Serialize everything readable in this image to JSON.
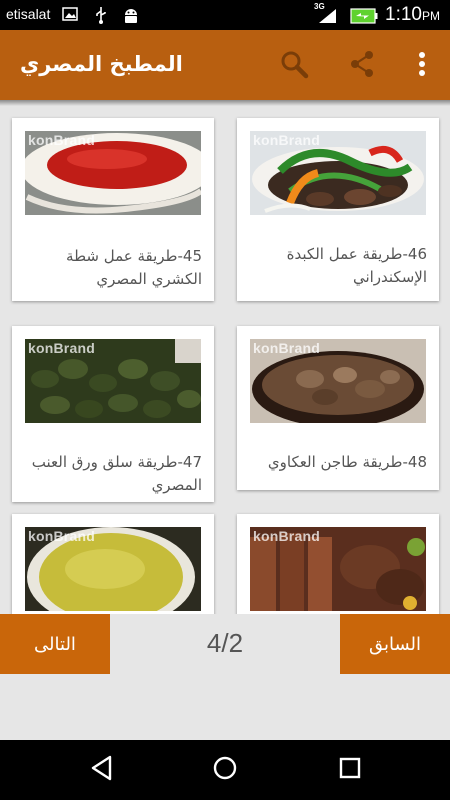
{
  "status_bar": {
    "carrier": "etisalat",
    "network": "3G",
    "time": "1:10",
    "ampm": "PM"
  },
  "app_bar": {
    "title": "المطبخ المصري",
    "icons": [
      "search-icon",
      "share-icon",
      "overflow-menu-icon"
    ]
  },
  "cards": [
    {
      "title": "46-طريقة عمل الكبدة الإسكندراني",
      "image": "liver-with-peppers",
      "watermark": [
        "kon",
        "Brand"
      ]
    },
    {
      "title": "45-طريقة عمل شطة الكشري المصري",
      "image": "red-chili-sauce",
      "watermark": [
        "kon",
        "Brand"
      ]
    },
    {
      "title": "48-طريقة طاجن العكاوي",
      "image": "oxtail-tagine",
      "watermark": [
        "kon",
        "Brand"
      ]
    },
    {
      "title": "47-طريقة سلق ورق العنب المصري",
      "image": "stuffed-grape-leaves",
      "watermark": [
        "kon",
        "Brand"
      ]
    },
    {
      "title": "",
      "image": "kofta-and-meat-grill",
      "watermark": [
        "kon",
        "Brand"
      ]
    },
    {
      "title": "",
      "image": "yellow-soup",
      "watermark": [
        "kon",
        "Brand"
      ]
    }
  ],
  "pager": {
    "prev_label": "السابق",
    "next_label": "التالى",
    "counter": "4/2"
  },
  "colors": {
    "app_bar": "#b85f10",
    "buttons": "#c9660a",
    "background": "#e6e6e6"
  }
}
